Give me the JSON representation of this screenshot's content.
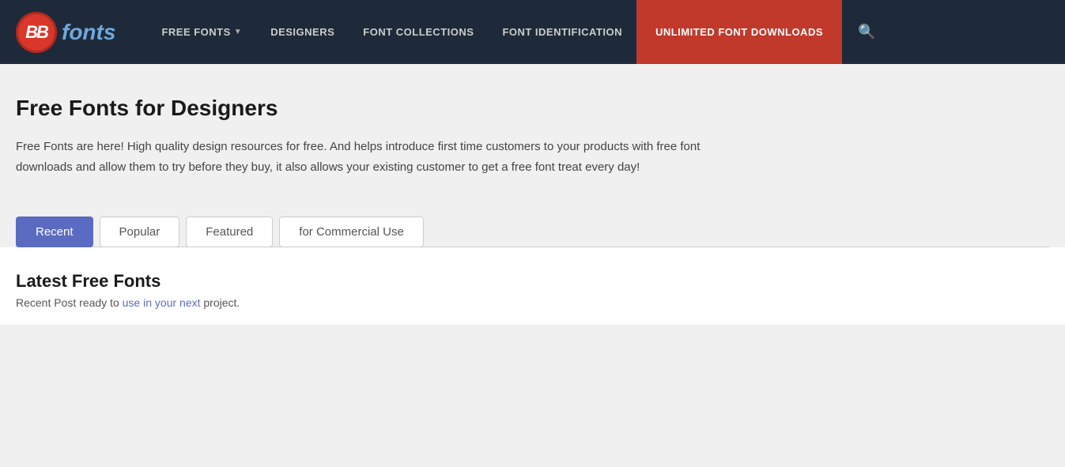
{
  "header": {
    "logo_bb": "BB",
    "logo_text": "fonts",
    "nav": {
      "free_fonts": "FREE FONTS",
      "designers": "DESIGNERS",
      "font_collections": "FONT COLLECTIONS",
      "font_identification": "FONT IDENTIFICATION",
      "cta": "UNLIMITED FONT DOWNLOADS"
    }
  },
  "main": {
    "page_title": "Free Fonts for Designers",
    "page_description": "Free Fonts are here! High quality design resources for free. And helps introduce first time customers to your products with free font downloads and allow them to try before they buy, it also allows your existing customer to get a free font treat every day!",
    "tabs": [
      {
        "id": "recent",
        "label": "Recent",
        "active": true
      },
      {
        "id": "popular",
        "label": "Popular",
        "active": false
      },
      {
        "id": "featured",
        "label": "Featured",
        "active": false
      },
      {
        "id": "commercial",
        "label": "for Commercial Use",
        "active": false
      }
    ],
    "latest_section": {
      "title": "Latest Free Fonts",
      "subtitle_pre": "Recent Post ready to use in your next project.",
      "subtitle_highlight1": "use",
      "subtitle_highlight2": "in",
      "subtitle_highlight3": "your",
      "subtitle_highlight4": "next"
    }
  }
}
